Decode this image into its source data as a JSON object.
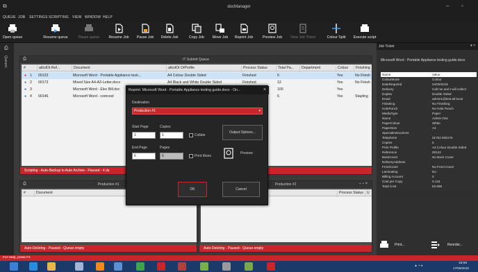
{
  "window": {
    "title": "docManager",
    "min": "–",
    "max": "▫"
  },
  "menu": [
    "QUEUE",
    "JOB",
    "SETTINGS",
    "SCRIPTING",
    "VIEW",
    "WINDOW",
    "HELP"
  ],
  "toolbar": [
    {
      "label": "Open queue",
      "icon": "printer-icon",
      "enabled": true
    },
    {
      "label": "Resume queue",
      "icon": "printer-resume-icon",
      "enabled": true
    },
    {
      "label": "Pause queue",
      "icon": "printer-pause-icon",
      "enabled": false
    },
    {
      "label": "Resume Job",
      "icon": "document-resume-icon",
      "enabled": true
    },
    {
      "label": "Pause Job",
      "icon": "document-pause-icon",
      "enabled": true
    },
    {
      "label": "Delete Job",
      "icon": "document-delete-icon",
      "enabled": true
    },
    {
      "label": "Copy Job",
      "icon": "copy-icon",
      "enabled": true
    },
    {
      "label": "Move Job",
      "icon": "move-icon",
      "enabled": true
    },
    {
      "label": "Reprint Job",
      "icon": "reprint-icon",
      "enabled": true
    },
    {
      "label": "Preview Job",
      "icon": "preview-icon",
      "enabled": true
    },
    {
      "label": "View Job Ticket",
      "icon": "ticket-icon",
      "enabled": false
    },
    {
      "label": "Colour Split",
      "icon": "colour-split-icon",
      "enabled": true
    },
    {
      "label": "Execute script",
      "icon": "script-icon",
      "enabled": true
    }
  ],
  "side_tab": "Queues",
  "top_queue": {
    "title": "IT Submit Queue",
    "columns": [
      "#",
      "atlcdOt Ref...",
      "Document",
      "atlcdOt O/Profile",
      "Process Status",
      "Total Pa...",
      "Department",
      "Colour",
      "Finishing"
    ],
    "rows": [
      {
        "n": "1",
        "ref": "00122",
        "doc": "Microsoft Word - Portable Appliance testi...",
        "profile": "A4 Colour Double Sided",
        "status": "Finished",
        "pages": "6",
        "dept": "",
        "colour": "Yes",
        "finishing": "No Finish"
      },
      {
        "n": "2",
        "ref": "00173",
        "doc": "Mixed Size A4-A3-Letter.docx",
        "profile": "A4 Black and White Double Sided",
        "status": "Finished",
        "pages": "12",
        "dept": "",
        "colour": "Yes",
        "finishing": "No Finish"
      },
      {
        "n": "3",
        "ref": "",
        "doc": "Microsoft Word - Elec Bill.doc",
        "profile": "",
        "status": "",
        "pages": "100",
        "dept": "",
        "colour": "Yes",
        "finishing": ""
      },
      {
        "n": "4",
        "ref": "00146",
        "doc": "Microsoft Word - comcost",
        "profile": "",
        "status": "",
        "pages": "6",
        "dept": "",
        "colour": "Yes",
        "finishing": "Stapling"
      }
    ],
    "status": "Scripting - Auto-Backup to Auto Archive - Paused - 4 do"
  },
  "prod1": {
    "title": "Production #1",
    "columns": [
      "#",
      "Document"
    ],
    "status": "Auto-Deleting - Paused - Queue empty"
  },
  "prod2": {
    "title": "Production #2",
    "columns": [
      "Process Status",
      "U"
    ],
    "status": "Auto-Deleting - Paused - Queue empty"
  },
  "dialog": {
    "title": "Reprint: Microsoft Word - Portable Appliance testing guide.docx - On...",
    "close": "×",
    "destination_label": "Destination",
    "destination_value": "Production #1",
    "start_page_label": "Start Page",
    "start_page": "1",
    "copies_label": "Copies",
    "copies": "1",
    "collate_label": "Collate",
    "end_page_label": "End Page",
    "end_page": "6",
    "pages_label": "Pages",
    "pages": "6",
    "print_mono_label": "Print Mono",
    "output_options": "Output Options...",
    "preview": "Preview",
    "ok": "OK",
    "cancel": "Cancel"
  },
  "job_ticket": {
    "header": "Job Ticket",
    "doc_title": "Microsoft Word - Portable Appliance testing guide.docx",
    "col_name": "Name",
    "col_value": "Value",
    "fields": [
      [
        "ColourMode",
        "Colour"
      ],
      [
        "DateRequired",
        "04/05/2015"
      ],
      [
        "Delivery",
        "Call me and I will collect"
      ],
      [
        "Duplex",
        "Double Sided"
      ],
      [
        "Email",
        "admin1@test.atl.local"
      ],
      [
        "Finishing",
        "No Finishing"
      ],
      [
        "HolePunch",
        "No Hole Punch"
      ],
      [
        "MediaType",
        "Paper"
      ],
      [
        "Name",
        "Admin One"
      ],
      [
        "PaperColour",
        "White"
      ],
      [
        "PaperSize",
        "A4"
      ],
      [
        "SpecialInstructions",
        ""
      ],
      [
        "Telephone",
        "01752 506176"
      ],
      [
        "Copies",
        "5"
      ],
      [
        "Print Profile",
        "A4 Colour Double Sided"
      ],
      [
        "Reference",
        "00122"
      ],
      [
        "BackCover",
        "No Back Cover"
      ],
      [
        "DeliveryAddress",
        ""
      ],
      [
        "FrontCover",
        "No Front Cover"
      ],
      [
        "Laminating",
        "No"
      ],
      [
        "Billing Account",
        "0"
      ],
      [
        "Cost per Copy",
        "0.134"
      ],
      [
        "Total Cost",
        "£0.668"
      ]
    ],
    "print_btn": "Print...",
    "reorder_btn": "Reorder..."
  },
  "statusline": "For Help, press F1",
  "tray": {
    "time": "18:59",
    "date": "17/06/2015"
  },
  "colors": {
    "accent": "#c8262a",
    "taskbar": "#1b3a6a"
  }
}
